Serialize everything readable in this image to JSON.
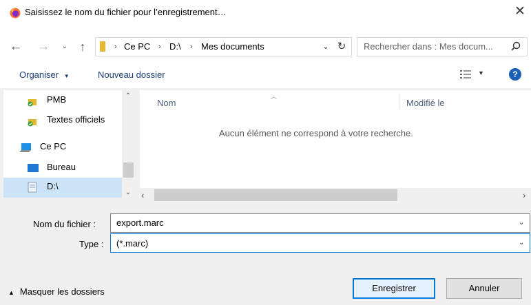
{
  "window": {
    "title": "Saisissez le nom du fichier pour l’enregistrement…",
    "close_glyph": "✕"
  },
  "address": {
    "crumbs": [
      "Ce PC",
      "D:\\",
      "Mes documents"
    ]
  },
  "search": {
    "placeholder": "Rechercher dans : Mes docum..."
  },
  "toolbar": {
    "organize_label": "Organiser",
    "new_folder_label": "Nouveau dossier",
    "help_label": "?"
  },
  "nav_pane": {
    "items": [
      {
        "label": "PMB",
        "icon": "folder-check-icon"
      },
      {
        "label": "Textes officiels",
        "icon": "folder-check-icon"
      },
      {
        "label": "Ce PC",
        "icon": "computer-icon"
      },
      {
        "label": "Bureau",
        "icon": "desktop-icon"
      },
      {
        "label": "D:\\",
        "icon": "drive-icon",
        "selected": true
      }
    ]
  },
  "file_list": {
    "columns": [
      "Nom",
      "Modifié le"
    ],
    "empty_message": "Aucun élément ne correspond à votre recherche."
  },
  "form": {
    "filename_label": "Nom du fichier :",
    "filename_value": "export.marc",
    "type_label": "Type :",
    "type_value": "(*.marc)"
  },
  "footer": {
    "hide_folders_label": "Masquer les dossiers",
    "save_label": "Enregistrer",
    "cancel_label": "Annuler"
  },
  "colors": {
    "accent": "#0078d7",
    "selection": "#cce4f7",
    "folder": "#e6b830"
  }
}
